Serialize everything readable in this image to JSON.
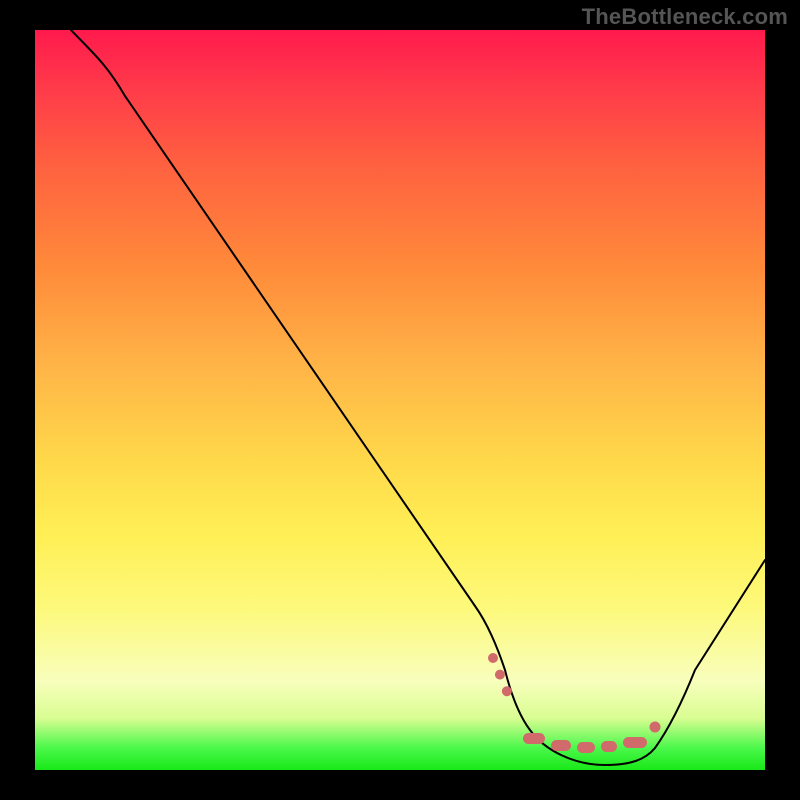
{
  "watermark": "TheBottleneck.com",
  "chart_data": {
    "type": "line",
    "title": "",
    "xlabel": "",
    "ylabel": "",
    "xlim": [
      0,
      100
    ],
    "ylim": [
      0,
      100
    ],
    "x": [
      5,
      10,
      15,
      20,
      25,
      30,
      35,
      40,
      45,
      50,
      55,
      60,
      62,
      65,
      68,
      71,
      74,
      77,
      80,
      82,
      85,
      90,
      95,
      100
    ],
    "values": [
      100,
      96,
      91,
      84,
      77,
      70,
      63,
      56,
      49,
      42,
      35,
      27,
      22,
      15,
      9,
      4,
      1,
      0,
      0,
      0,
      1,
      6,
      15,
      28
    ],
    "highlight_x_range": [
      62,
      83
    ],
    "background_gradient": {
      "top": "#ff1a4d",
      "upper_mid": "#ff8a3a",
      "mid": "#ffe84f",
      "lower_mid": "#f8febc",
      "bottom": "#18e818"
    },
    "annotations": [],
    "grid": false
  }
}
